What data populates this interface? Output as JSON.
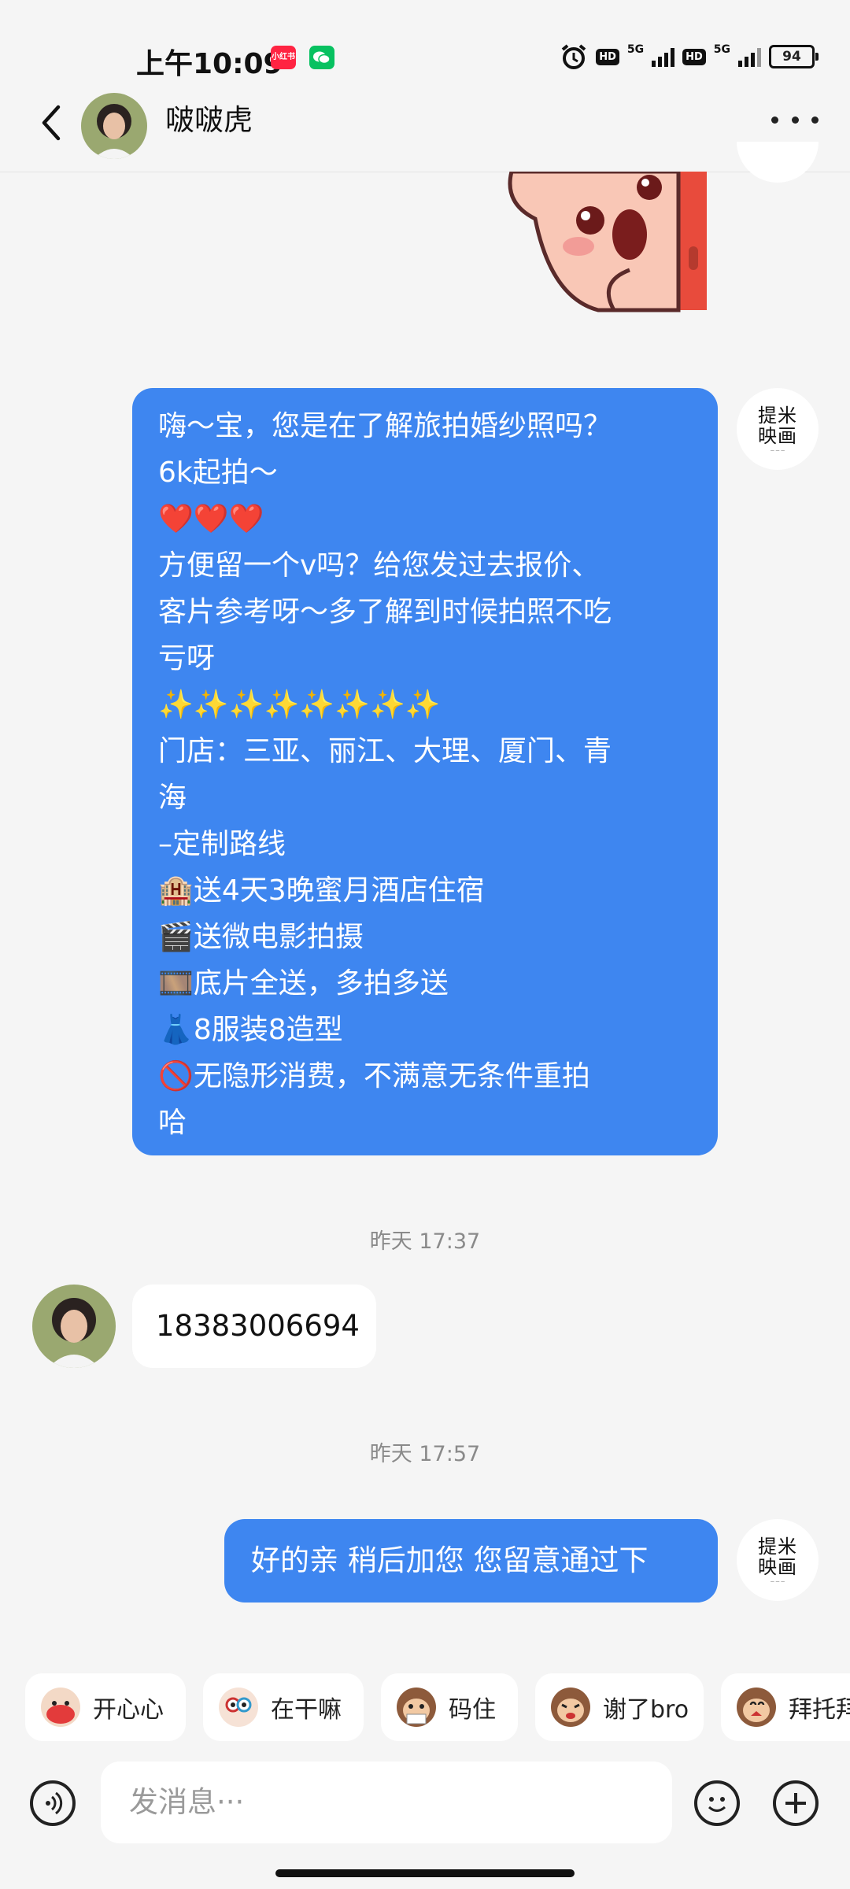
{
  "status_bar": {
    "time": "上午10:09",
    "badges": [
      "小红书",
      "wechat"
    ],
    "network_labels": [
      "HD",
      "5G",
      "HD",
      "5G"
    ],
    "battery": "94"
  },
  "header": {
    "contact_name": "啵啵虎"
  },
  "brand": {
    "logo_text": "提米\n映画"
  },
  "messages": [
    {
      "from": "me",
      "type": "text",
      "lines": [
        "嗨～宝，您是在了解旅拍婚纱照吗？",
        "6k起拍～",
        "❤️❤️❤️",
        "方便留一个v吗？给您发过去报价、",
        "客片参考呀～多了解到时候拍照不吃",
        "亏呀",
        "✨✨✨✨✨✨✨✨",
        "门店：三亚、丽江、大理、厦门、青",
        "海",
        "–定制路线",
        "🏨送4天3晚蜜月酒店住宿",
        "🎬送微电影拍摄",
        "🎞️底片全送，多拍多送",
        "👗8服装8造型",
        "🚫无隐形消费，不满意无条件重拍",
        "哈"
      ]
    },
    {
      "type": "timestamp",
      "text": "昨天 17:37"
    },
    {
      "from": "them",
      "type": "text",
      "text": "18383006694"
    },
    {
      "type": "timestamp",
      "text": "昨天 17:57"
    },
    {
      "from": "me",
      "type": "text",
      "text": "好的亲 稍后加您 您留意通过下"
    }
  ],
  "quick_replies": [
    {
      "label": "开心心",
      "icon": "happy-sticker-icon"
    },
    {
      "label": "在干嘛",
      "icon": "curious-sticker-icon"
    },
    {
      "label": "码住",
      "icon": "monkey-note-icon"
    },
    {
      "label": "谢了bro",
      "icon": "monkey-thanks-icon"
    },
    {
      "label": "拜托拜",
      "icon": "monkey-please-icon"
    }
  ],
  "input": {
    "placeholder": "发消息···"
  },
  "colors": {
    "my_bubble": "#3e86f0",
    "their_bubble": "#ffffff",
    "background": "#f5f5f5"
  }
}
